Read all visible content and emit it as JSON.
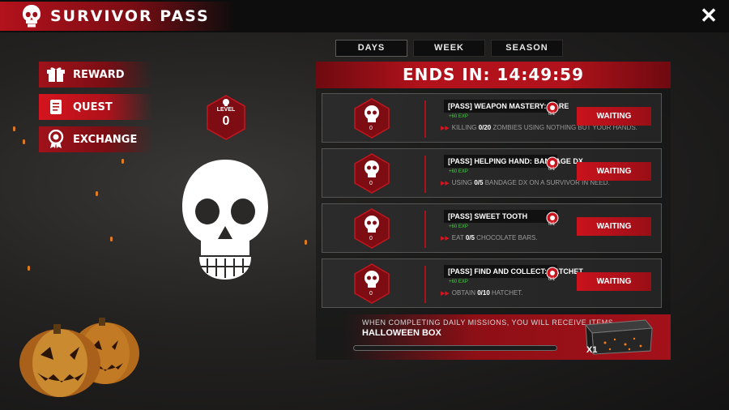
{
  "header": {
    "title": "SURVIVOR PASS",
    "close_label": "✕"
  },
  "tabs": [
    {
      "label": "DAYS",
      "active": true
    },
    {
      "label": "WEEK",
      "active": false
    },
    {
      "label": "SEASON",
      "active": false
    }
  ],
  "menu": [
    {
      "label": "REWARD",
      "icon": "gift-icon",
      "active": false
    },
    {
      "label": "QUEST",
      "icon": "scroll-icon",
      "active": true
    },
    {
      "label": "EXCHANGE",
      "icon": "badge-icon",
      "active": false
    }
  ],
  "level": {
    "label": "LEVEL",
    "value": "0"
  },
  "timer": {
    "label": "ENDS IN: 14:49:59"
  },
  "quests": [
    {
      "title": "[PASS] WEAPON MASTERY: BARE",
      "exp": "+60 EXP",
      "desc_prefix": "KILLING ",
      "desc_count": "0/20",
      "desc_suffix": " ZOMBIES USING NOTHING BUT YOUR HANDS.",
      "progress": "0/1",
      "hex_value": "0",
      "button": "WAITING"
    },
    {
      "title": "[PASS] HELPING HAND: BANDAGE DX",
      "exp": "+60 EXP",
      "desc_prefix": "USING ",
      "desc_count": "0/5",
      "desc_suffix": " BANDAGE DX ON A SURVIVOR IN NEED.",
      "progress": "0/1",
      "hex_value": "0",
      "button": "WAITING"
    },
    {
      "title": "[PASS] SWEET TOOTH",
      "exp": "+60 EXP",
      "desc_prefix": "EAT ",
      "desc_count": "0/5",
      "desc_suffix": " CHOCOLATE BARS.",
      "progress": "0/1",
      "hex_value": "0",
      "button": "WAITING"
    },
    {
      "title": "[PASS] FIND AND COLLECT: HATCHET",
      "exp": "+60 EXP",
      "desc_prefix": "OBTAIN ",
      "desc_count": "0/10",
      "desc_suffix": " HATCHET.",
      "progress": "0/1",
      "hex_value": "0",
      "button": "WAITING"
    }
  ],
  "reward": {
    "info": "WHEN COMPLETING DAILY MISSIONS, YOU WILL RECEIVE ITEMS.",
    "name": "HALLOWEEN BOX",
    "quantity": "X1",
    "progress_fraction": 0
  },
  "colors": {
    "accent": "#c9131d",
    "exp": "#3fcf3f",
    "background": "#232221"
  }
}
